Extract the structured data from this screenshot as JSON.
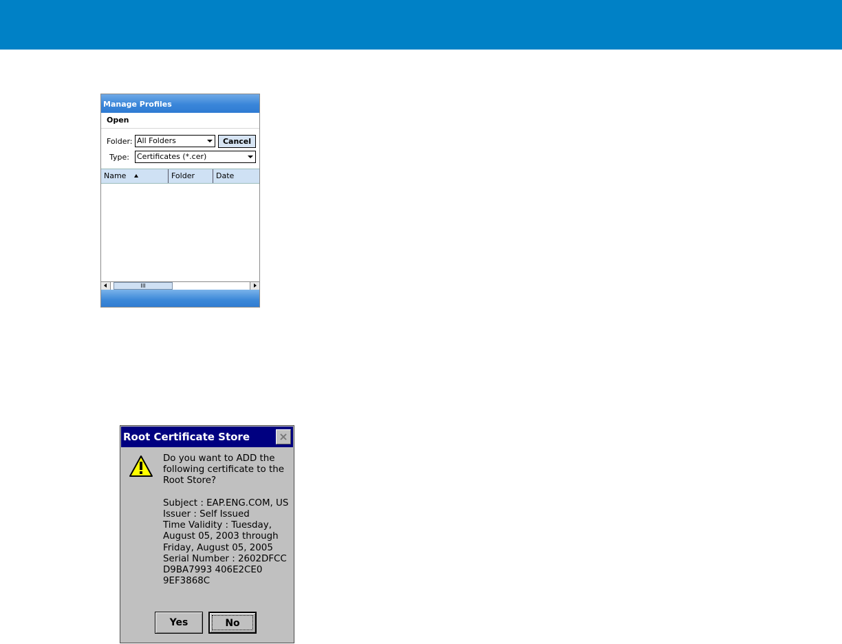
{
  "colors": {
    "top_banner": "#0081c6",
    "dialog_title_bar": "#000080",
    "dialog_face": "#c0c0c0",
    "mp_title_bar": "#3a86d9"
  },
  "manage_profiles": {
    "title": "Manage Profiles",
    "menu_open": "Open",
    "folder_label": "Folder:",
    "folder_value": "All Folders",
    "cancel_label": "Cancel",
    "type_label": "Type:",
    "type_value": "Certificates (*.cer)",
    "columns": [
      "Name",
      "Folder",
      "Date"
    ],
    "scroll_thumb_glyph": "III",
    "icons": {
      "sort": "sort-ascending-icon",
      "left": "scroll-left-icon",
      "right": "scroll-right-icon",
      "dropdown": "chevron-down-icon"
    }
  },
  "root_cert_dialog": {
    "title": "Root Certificate Store",
    "close_glyph": "×",
    "icon": "warning-icon",
    "message": "Do you want to ADD the following certificate to the Root Store?\n\nSubject : EAP.ENG.COM, US\nIssuer : Self Issued\nTime Validity : Tuesday, August 05, 2003 through Friday, August 05, 2005\nSerial Number : 2602DFCC D9BA7993 406E2CE0 9EF3868C",
    "yes_label": "Yes",
    "no_label": "No"
  }
}
